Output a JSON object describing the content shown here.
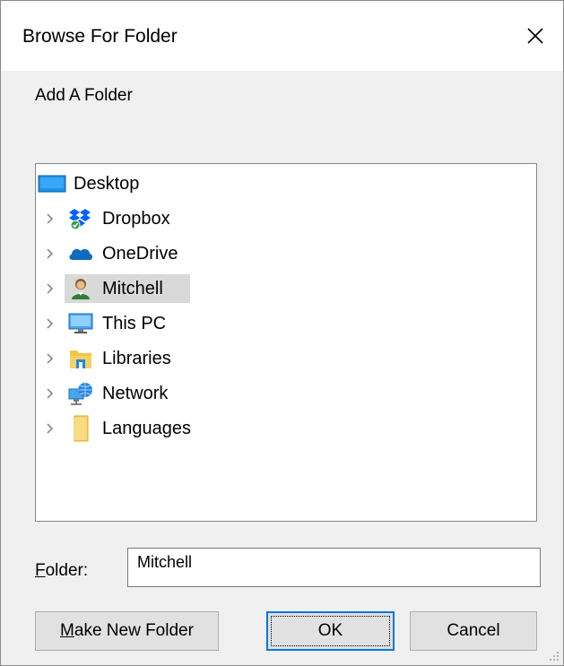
{
  "window": {
    "title": "Browse For Folder"
  },
  "instruction": "Add A Folder",
  "tree": {
    "root": {
      "label": "Desktop",
      "icon": "desktop-icon"
    },
    "items": [
      {
        "label": "Dropbox",
        "icon": "dropbox-icon",
        "selected": false
      },
      {
        "label": "OneDrive",
        "icon": "onedrive-icon",
        "selected": false
      },
      {
        "label": "Mitchell",
        "icon": "user-folder-icon",
        "selected": true
      },
      {
        "label": "This PC",
        "icon": "computer-icon",
        "selected": false
      },
      {
        "label": "Libraries",
        "icon": "libraries-icon",
        "selected": false
      },
      {
        "label": "Network",
        "icon": "network-icon",
        "selected": false
      },
      {
        "label": "Languages",
        "icon": "folder-icon",
        "selected": false
      }
    ]
  },
  "folder": {
    "label_underlined": "F",
    "label_rest": "older:",
    "value": "Mitchell"
  },
  "buttons": {
    "make_new_folder_underlined": "M",
    "make_new_folder_rest": "ake New Folder",
    "ok": "OK",
    "cancel": "Cancel"
  },
  "colors": {
    "dialog_bg": "#f0f0f0",
    "titlebar_bg": "#ffffff",
    "selection_bg": "#d9d9d9",
    "default_button_border": "#0078d7"
  }
}
